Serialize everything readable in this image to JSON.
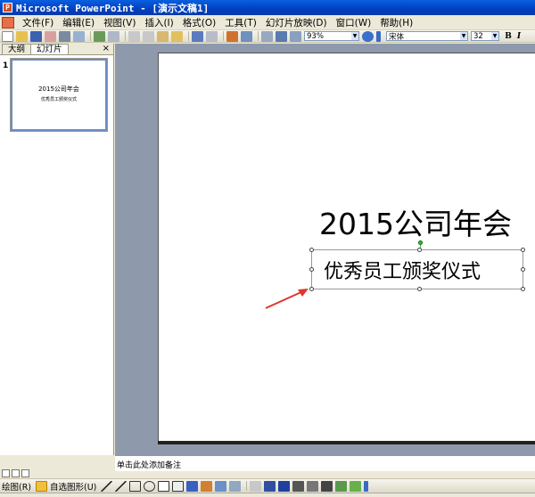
{
  "window": {
    "title": "Microsoft PowerPoint - [演示文稿1]"
  },
  "menu": {
    "items": [
      "文件(F)",
      "编辑(E)",
      "视图(V)",
      "插入(I)",
      "格式(O)",
      "工具(T)",
      "幻灯片放映(D)",
      "窗口(W)",
      "帮助(H)"
    ]
  },
  "toolbar": {
    "zoom": "93%",
    "font_name": "宋体",
    "font_size": "32",
    "bold_label": "B",
    "italic_label": "I"
  },
  "left_pane": {
    "tab_outline": "大纲",
    "tab_slides": "幻灯片",
    "close": "×",
    "slide_number": "1",
    "thumb_title": "2015公司年会",
    "thumb_subtitle": "优秀员工颁奖仪式"
  },
  "slide": {
    "title": "2015公司年会",
    "subtitle": "优秀员工颁奖仪式"
  },
  "notes": {
    "placeholder": "单击此处添加备注"
  },
  "drawing_toolbar": {
    "draw_label": "绘图(R)",
    "autoshapes_label": "自选图形(U)"
  },
  "colors": {
    "accent_arrow": "#e0352b",
    "title_bar": "#0a5fe0",
    "stage_bg": "#8e99ac"
  }
}
